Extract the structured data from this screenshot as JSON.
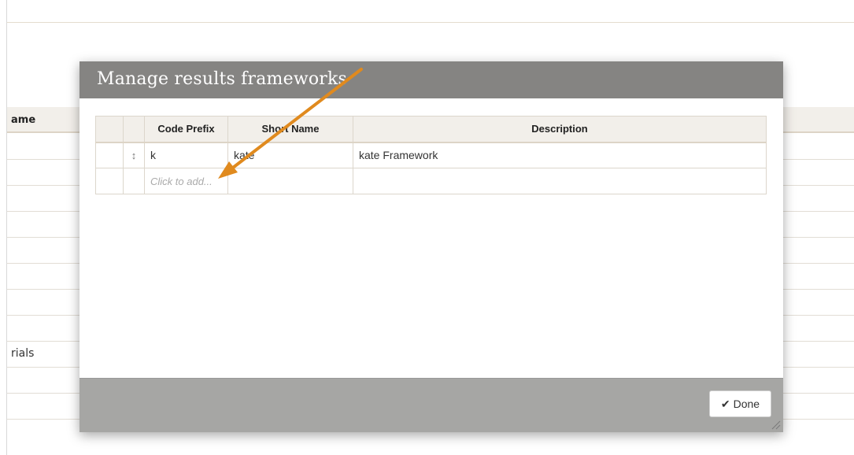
{
  "background": {
    "header_text": "ame",
    "row_text": "rials"
  },
  "dialog": {
    "title": "Manage results frameworks",
    "table": {
      "headers": [
        "",
        "",
        "Code Prefix",
        "Short Name",
        "Description"
      ],
      "rows": [
        {
          "code_prefix": "k",
          "short_name": "kate",
          "description": "kate Framework"
        }
      ],
      "add_placeholder": "Click to add..."
    },
    "done_label": "Done"
  },
  "icons": {
    "drag": "up-down-arrow-icon",
    "check": "check-icon"
  },
  "colors": {
    "header_bg": "#858482",
    "footer_bg": "#a6a6a4",
    "arrow": "#e08a1e"
  }
}
